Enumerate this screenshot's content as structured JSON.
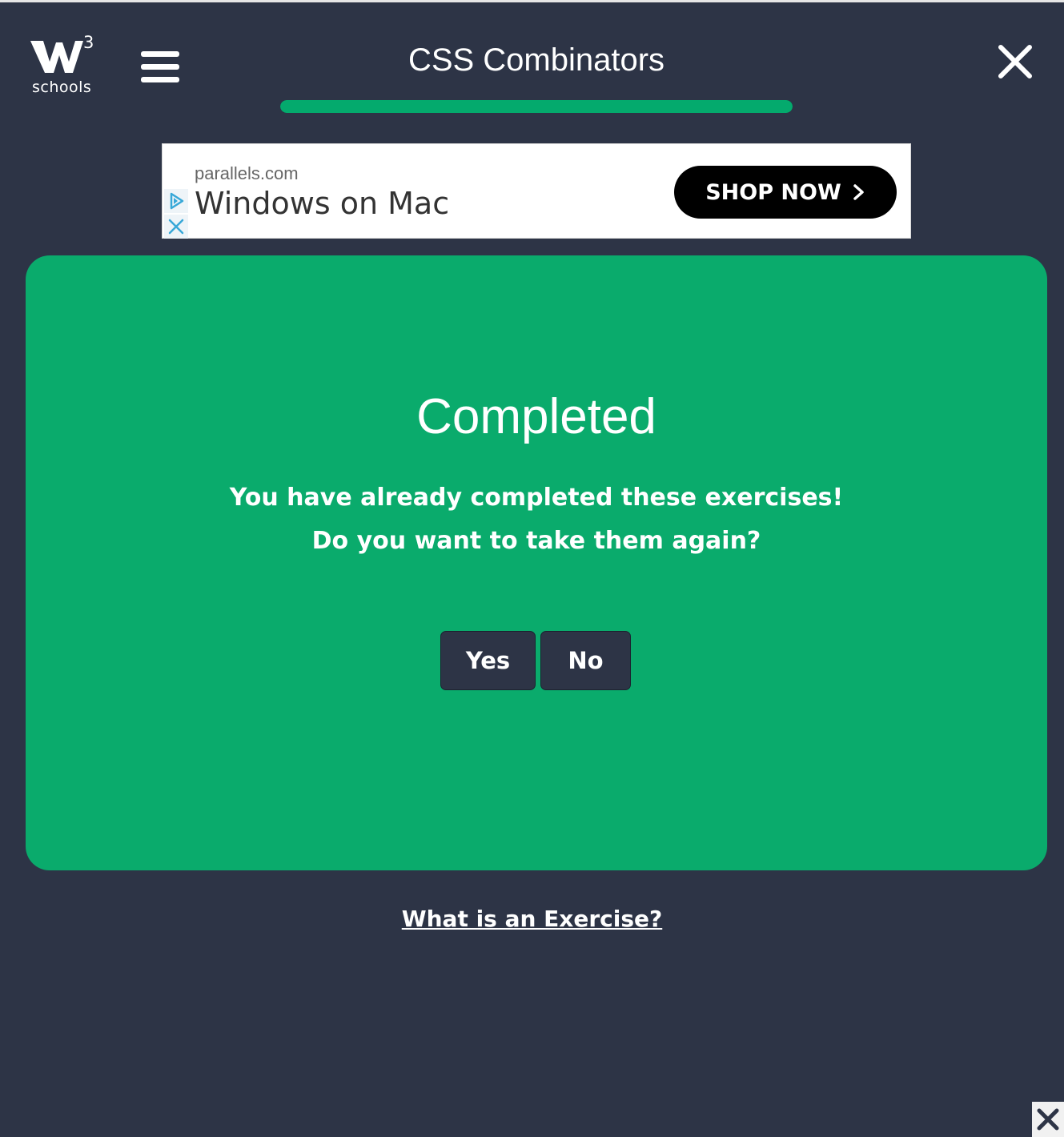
{
  "header": {
    "logo_text": "schools",
    "logo_superscript": "3",
    "title": "CSS Combinators",
    "progress_fraction": 1.0
  },
  "ad": {
    "domain": "parallels.com",
    "headline": "Windows on Mac",
    "cta_label": "SHOP NOW"
  },
  "card": {
    "title": "Completed",
    "message_line1": "You have already completed these exercises!",
    "message_line2": "Do you want to take them again?",
    "yes_label": "Yes",
    "no_label": "No"
  },
  "footer": {
    "help_link": "What is an Exercise?"
  },
  "colors": {
    "background": "#2d3446",
    "accent_green": "#04aa6d",
    "card_green": "#0aab6c"
  }
}
